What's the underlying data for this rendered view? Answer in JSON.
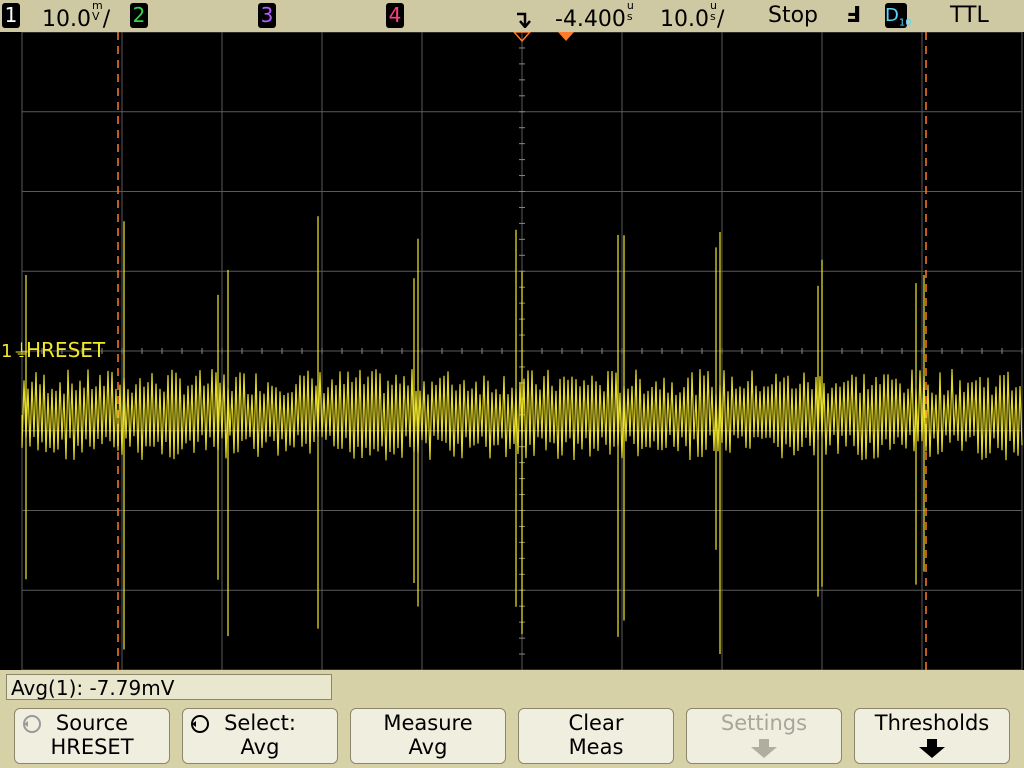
{
  "status_bar": {
    "ch1": {
      "num": "1",
      "scale": "10.0",
      "unit_top": "m",
      "unit_bot": "V",
      "suffix": "/"
    },
    "ch2": {
      "num": "2"
    },
    "ch3": {
      "num": "3"
    },
    "ch4": {
      "num": "4"
    },
    "delay": {
      "value": "-4.400",
      "unit_top": "u",
      "unit_bot": "s"
    },
    "timebase": {
      "value": "10.0",
      "unit_top": "u",
      "unit_bot": "s",
      "suffix": "/"
    },
    "run_state": "Stop",
    "trigger_slope": "Ⅎ",
    "digital": {
      "letter": "D",
      "sub": "10"
    },
    "logic": "TTL"
  },
  "waveform": {
    "channel_label": "HRESET",
    "channel_marker": "1"
  },
  "measurement": {
    "readout": "Avg(1): -7.79mV"
  },
  "softkeys": [
    {
      "line1": "Source",
      "line2": "HRESET",
      "knob": true,
      "disabled": false
    },
    {
      "line1": "Select:",
      "line2": "Avg",
      "knob": true,
      "disabled": false
    },
    {
      "line1": "Measure",
      "line2": "Avg",
      "knob": false,
      "disabled": false
    },
    {
      "line1": "Clear",
      "line2": "Meas",
      "knob": false,
      "disabled": false
    },
    {
      "line1": "Settings",
      "line2": "",
      "knob": false,
      "disabled": true,
      "arrow": "down"
    },
    {
      "line1": "Thresholds",
      "line2": "",
      "knob": false,
      "disabled": false,
      "arrow": "down"
    }
  ],
  "colors": {
    "ch1": "#f2e829",
    "ch2": "#34d34a",
    "ch3": "#b45cff",
    "ch4": "#ff3f7f",
    "grid": "#5a5a5a",
    "cursor": "#ff7a2a"
  }
}
